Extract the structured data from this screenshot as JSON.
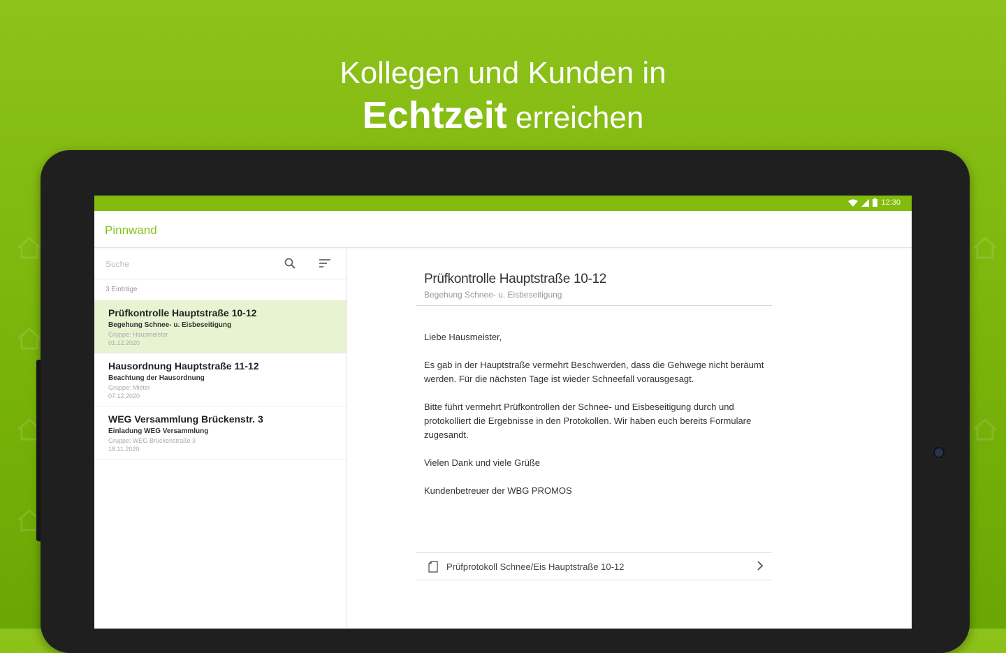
{
  "headline": {
    "line1": "Kollegen und Kunden in",
    "line2_bold": "Echtzeit",
    "line2_rest": " erreichen"
  },
  "status_bar": {
    "time": "12:30",
    "icons": [
      "wifi-icon",
      "signal-icon",
      "battery-icon"
    ]
  },
  "app_bar": {
    "title": "Pinnwand"
  },
  "search": {
    "placeholder": "Suche",
    "icons": [
      "search-icon",
      "sort-icon"
    ]
  },
  "list": {
    "count_label": "3 Einträge",
    "items": [
      {
        "title": "Prüfkontrolle Hauptstraße 10-12",
        "subtitle": "Begehung Schnee- u. Eisbeseitigung",
        "group": "Gruppe: Hausmeister",
        "date": "01.12.2020",
        "selected": true
      },
      {
        "title": "Hausordnung Hauptstraße 11-12",
        "subtitle": "Beachtung der Hausordnung",
        "group": "Gruppe: Mieter",
        "date": "07.12.2020",
        "selected": false
      },
      {
        "title": "WEG Versammlung Brückenstr. 3",
        "subtitle": "Einladung WEG Versammlung",
        "group": "Gruppe: WEG Brückenstraße 3",
        "date": "18.11.2020",
        "selected": false
      }
    ]
  },
  "detail": {
    "title": "Prüfkontrolle Hauptstraße 10-12",
    "subtitle": "Begehung Schnee- u. Eisbeseitigung",
    "body": [
      "Liebe Hausmeister,",
      "Es gab in der Hauptstraße vermehrt Beschwerden, dass die Gehwege nicht beräumt werden. Für die nächsten Tage ist wieder Schneefall vorausgesagt.",
      "Bitte führt vermehrt Prüfkontrollen der Schnee- und Eisbeseitigung durch und protokolliert die Ergebnisse in den Protokollen. Wir haben euch bereits Formulare zugesandt.",
      "Vielen Dank und viele Grüße",
      "Kundenbetreuer der WBG PROMOS"
    ],
    "attachment": {
      "name": "Prüfprotokoll Schnee/Eis Hauptstraße 10-12",
      "icon": "document-icon",
      "action_icon": "chevron-right-icon"
    }
  },
  "colors": {
    "background_green": "#7ab40a",
    "accent_green": "#86c21a",
    "selected_row": "#e8f3d2",
    "tablet_frame": "#1f1f1f"
  }
}
